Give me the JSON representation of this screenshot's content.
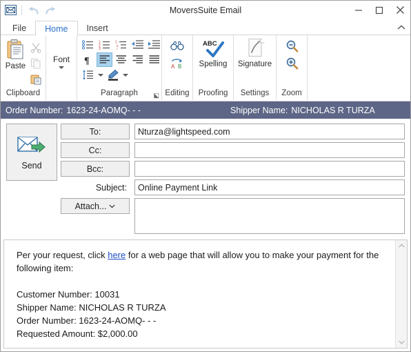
{
  "window": {
    "title": "MoversSuite Email",
    "app_icon": "envelope-icon",
    "quick_access": [
      {
        "name": "undo-button",
        "icon": "undo-arrow-icon",
        "enabled": false
      },
      {
        "name": "redo-button",
        "icon": "redo-arrow-icon",
        "enabled": false
      }
    ],
    "controls": {
      "minimize": "minimize-button",
      "maximize": "maximize-button",
      "close": "close-button"
    }
  },
  "tabs": [
    {
      "label": "File",
      "active": false
    },
    {
      "label": "Home",
      "active": true
    },
    {
      "label": "Insert",
      "active": false
    }
  ],
  "ribbon": {
    "collapse_label": "^",
    "groups": [
      {
        "label": "Clipboard",
        "items": [
          {
            "name": "paste-button",
            "label": "Paste"
          },
          {
            "name": "cut-button",
            "label": "Cut"
          },
          {
            "name": "copy-button",
            "label": "Copy"
          },
          {
            "name": "format-painter-button",
            "label": "Format Painter"
          }
        ]
      },
      {
        "label": "Font",
        "items": [
          {
            "name": "font-dropdown",
            "label": "Font"
          }
        ]
      },
      {
        "label": "Paragraph",
        "items": [
          {
            "name": "bullets-button",
            "label": "Bullets"
          },
          {
            "name": "numbering-button",
            "label": "Numbering"
          },
          {
            "name": "multilevel-list-button",
            "label": "Multilevel List"
          },
          {
            "name": "decrease-indent-button",
            "label": "Decrease Indent"
          },
          {
            "name": "increase-indent-button",
            "label": "Increase Indent"
          },
          {
            "name": "show-formatting-marks-button",
            "label": "Show/Hide"
          },
          {
            "name": "align-left-button",
            "label": "Align Left"
          },
          {
            "name": "align-center-button",
            "label": "Center"
          },
          {
            "name": "align-right-button",
            "label": "Align Right"
          },
          {
            "name": "justify-button",
            "label": "Justify"
          },
          {
            "name": "line-spacing-button",
            "label": "Line Spacing"
          },
          {
            "name": "shading-button",
            "label": "Shading"
          }
        ]
      },
      {
        "label": "Editing",
        "items": [
          {
            "name": "find-button",
            "label": "Find"
          },
          {
            "name": "replace-button",
            "label": "Replace"
          }
        ]
      },
      {
        "label": "Proofing",
        "items": [
          {
            "name": "spelling-button",
            "label": "Spelling"
          }
        ]
      },
      {
        "label": "Settings",
        "items": [
          {
            "name": "signature-button",
            "label": "Signature"
          }
        ]
      },
      {
        "label": "Zoom",
        "items": [
          {
            "name": "zoom-out-button",
            "label": "Zoom Out"
          },
          {
            "name": "zoom-in-button",
            "label": "Zoom In"
          }
        ]
      }
    ],
    "labels": {
      "clipboard": "Clipboard",
      "font": "Font",
      "paragraph": "Paragraph",
      "editing": "Editing",
      "proofing": "Proofing",
      "settings": "Settings",
      "zoom": "Zoom",
      "spelling": "Spelling",
      "signature": "Signature",
      "paste": "Paste"
    }
  },
  "order_bar": {
    "order_number_label": "Order Number:",
    "order_number_value": "1623-24-AOMQ- - -",
    "shipper_name_label": "Shipper Name:",
    "shipper_name_value": "NICHOLAS R TURZA",
    "background_color": "#5d6686"
  },
  "compose": {
    "send_label": "Send",
    "to_label": "To:",
    "to_value": "Nturza@lightspeed.com",
    "cc_label": "Cc:",
    "cc_value": "",
    "bcc_label": "Bcc:",
    "bcc_value": "",
    "subject_label": "Subject:",
    "subject_value": "Online Payment Link",
    "attach_label": "Attach...",
    "attach_value": ""
  },
  "message_body": {
    "intro_before_link": "Per your request, click ",
    "link_text": "here",
    "intro_after_link": " for a web page that will allow you to make your payment for the following item:",
    "details": [
      "Customer Number: 10031",
      "Shipper Name: NICHOLAS R TURZA",
      "Order Number: 1623-24-AOMQ- - -",
      "Requested Amount: $2,000.00"
    ]
  },
  "colors": {
    "accent_tab": "#2a6fc9",
    "order_bar": "#5d6686",
    "link": "#1b4ec4",
    "selection": "#a8d3f0"
  }
}
